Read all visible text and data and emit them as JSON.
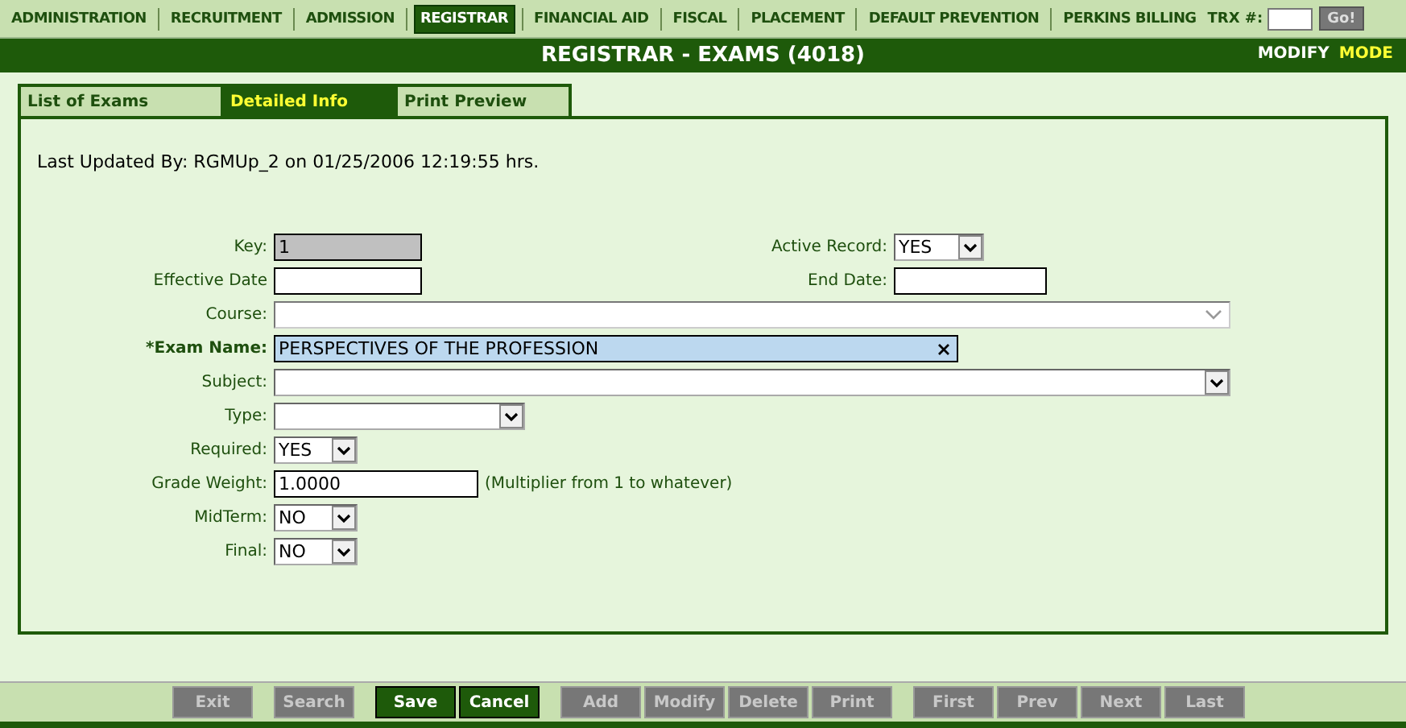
{
  "nav": {
    "items": [
      {
        "label": "ADMINISTRATION",
        "selected": false
      },
      {
        "label": "RECRUITMENT",
        "selected": false
      },
      {
        "label": "ADMISSION",
        "selected": false
      },
      {
        "label": "REGISTRAR",
        "selected": true
      },
      {
        "label": "FINANCIAL AID",
        "selected": false
      },
      {
        "label": "FISCAL",
        "selected": false
      },
      {
        "label": "PLACEMENT",
        "selected": false
      },
      {
        "label": "DEFAULT PREVENTION",
        "selected": false
      },
      {
        "label": "PERKINS BILLING",
        "selected": false
      }
    ],
    "trx_label": "TRX #:",
    "go_button": "Go!"
  },
  "title_bar": {
    "title": "REGISTRAR - EXAMS (4018)",
    "mode": "MODIFY",
    "mode_label": "MODE"
  },
  "tabs": [
    {
      "label": "List of Exams",
      "selected": false
    },
    {
      "label": "Detailed Info",
      "selected": true
    },
    {
      "label": "Print Preview",
      "selected": false
    }
  ],
  "last_updated": "Last Updated By: RGMUp_2 on 01/25/2006 12:19:55 hrs.",
  "rows": [
    {
      "left": {
        "label": "Key:",
        "kind": "text",
        "value": "1",
        "disabled": true
      },
      "right": {
        "label": "Active Record:",
        "kind": "select",
        "value": "YES"
      }
    },
    {
      "left": {
        "label": "Effective Date",
        "kind": "text"
      },
      "right": {
        "label": "End Date:",
        "kind": "text"
      }
    },
    {
      "left": {
        "label": "Course:",
        "kind": "combo"
      }
    },
    {
      "left": {
        "label": "*Exam Name:",
        "kind": "clearable",
        "value": "PERSPECTIVES OF THE PROFESSION",
        "required": true
      }
    },
    {
      "left": {
        "label": "Subject:",
        "kind": "select"
      }
    },
    {
      "left": {
        "label": "Type:",
        "kind": "select"
      }
    },
    {
      "left": {
        "label": "Required:",
        "kind": "select",
        "value": "YES"
      }
    },
    {
      "left": {
        "label": "Grade Weight:",
        "kind": "text",
        "value": "1.0000",
        "note": "(Multiplier from 1 to whatever)"
      }
    },
    {
      "left": {
        "label": "MidTerm:",
        "kind": "select",
        "value": "NO"
      }
    },
    {
      "left": {
        "label": "Final:",
        "kind": "select",
        "value": "NO"
      }
    }
  ],
  "button_groups": [
    [
      {
        "label": "Exit",
        "enabled": false
      }
    ],
    [
      {
        "label": "Search",
        "enabled": false
      }
    ],
    [
      {
        "label": "Save",
        "enabled": true
      },
      {
        "label": "Cancel",
        "enabled": true
      }
    ],
    [
      {
        "label": "Add",
        "enabled": false
      },
      {
        "label": "Modify",
        "enabled": false
      },
      {
        "label": "Delete",
        "enabled": false
      },
      {
        "label": "Print",
        "enabled": false
      }
    ],
    [
      {
        "label": "First",
        "enabled": false
      },
      {
        "label": "Prev",
        "enabled": false
      },
      {
        "label": "Next",
        "enabled": false
      },
      {
        "label": "Last",
        "enabled": false
      }
    ]
  ]
}
